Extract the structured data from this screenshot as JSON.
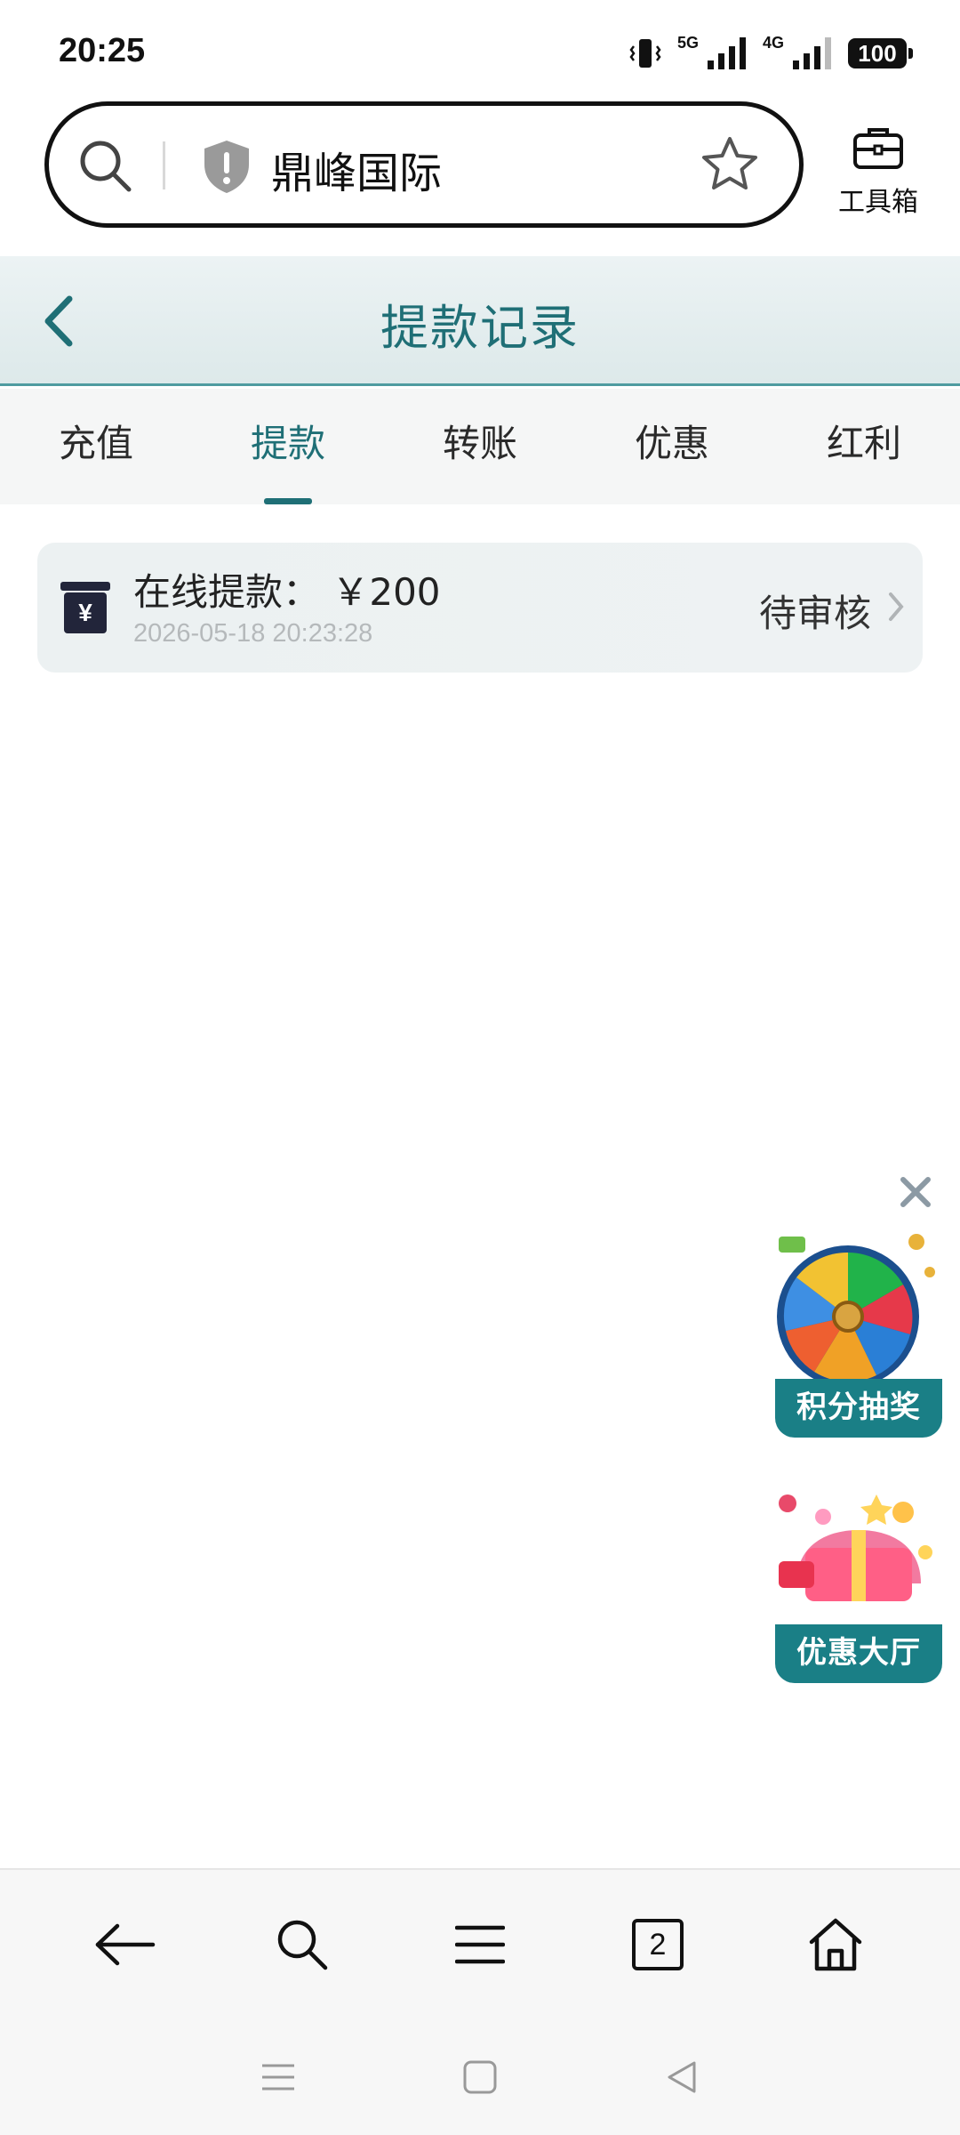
{
  "status_bar": {
    "time": "20:25",
    "network_5g": "5G",
    "network_4g": "4G",
    "battery": "100"
  },
  "browser": {
    "address_text": "鼎峰国际",
    "toolbox_label": "工具箱"
  },
  "header": {
    "title": "提款记录"
  },
  "tabs": [
    {
      "label": "充值",
      "active": false
    },
    {
      "label": "提款",
      "active": true
    },
    {
      "label": "转账",
      "active": false
    },
    {
      "label": "优惠",
      "active": false
    },
    {
      "label": "红利",
      "active": false
    }
  ],
  "records": [
    {
      "title": "在线提款： ￥200",
      "time": "2026-05-18 20:23:28",
      "status": "待审核",
      "icon": "cashier-icon"
    }
  ],
  "floats": {
    "lottery_label": "积分抽奖",
    "promo_label": "优惠大厅"
  },
  "bottom_nav": {
    "tab_count": "2"
  },
  "colors": {
    "accent": "#1f6f76",
    "header_bg": "#e4eeef",
    "card_bg": "#edf2f3"
  }
}
